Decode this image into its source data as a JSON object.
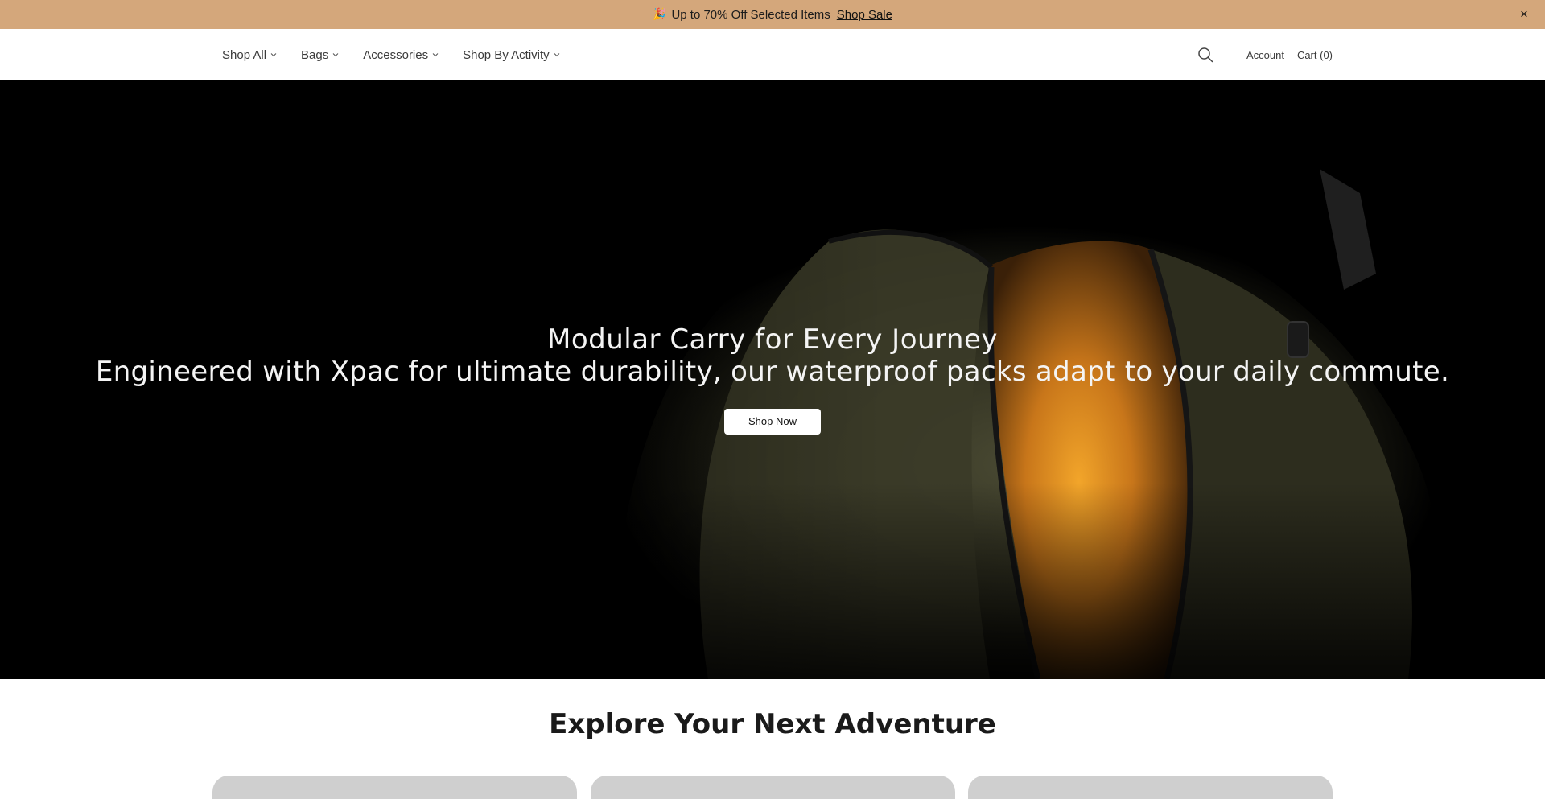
{
  "announcement": {
    "emoji": "🎉",
    "text": "Up to 70% Off Selected Items",
    "link_label": "Shop Sale",
    "close_glyph": "×",
    "background": "#d4a77b"
  },
  "nav": {
    "items": [
      {
        "label": "Shop All"
      },
      {
        "label": "Bags"
      },
      {
        "label": "Accessories"
      },
      {
        "label": "Shop By Activity"
      }
    ],
    "account_label": "Account",
    "cart_label": "Cart (0)"
  },
  "hero": {
    "title": "Modular Carry for Every Journey",
    "subtitle": "Engineered with Xpac for ultimate durability, our waterproof packs adapt to your daily commute.",
    "cta_label": "Shop Now",
    "image_subject": "open olive-green backpack with orange interior"
  },
  "explore": {
    "title": "Explore Your Next Adventure",
    "cards": [
      {
        "index": 1
      },
      {
        "index": 2
      },
      {
        "index": 3
      }
    ]
  }
}
